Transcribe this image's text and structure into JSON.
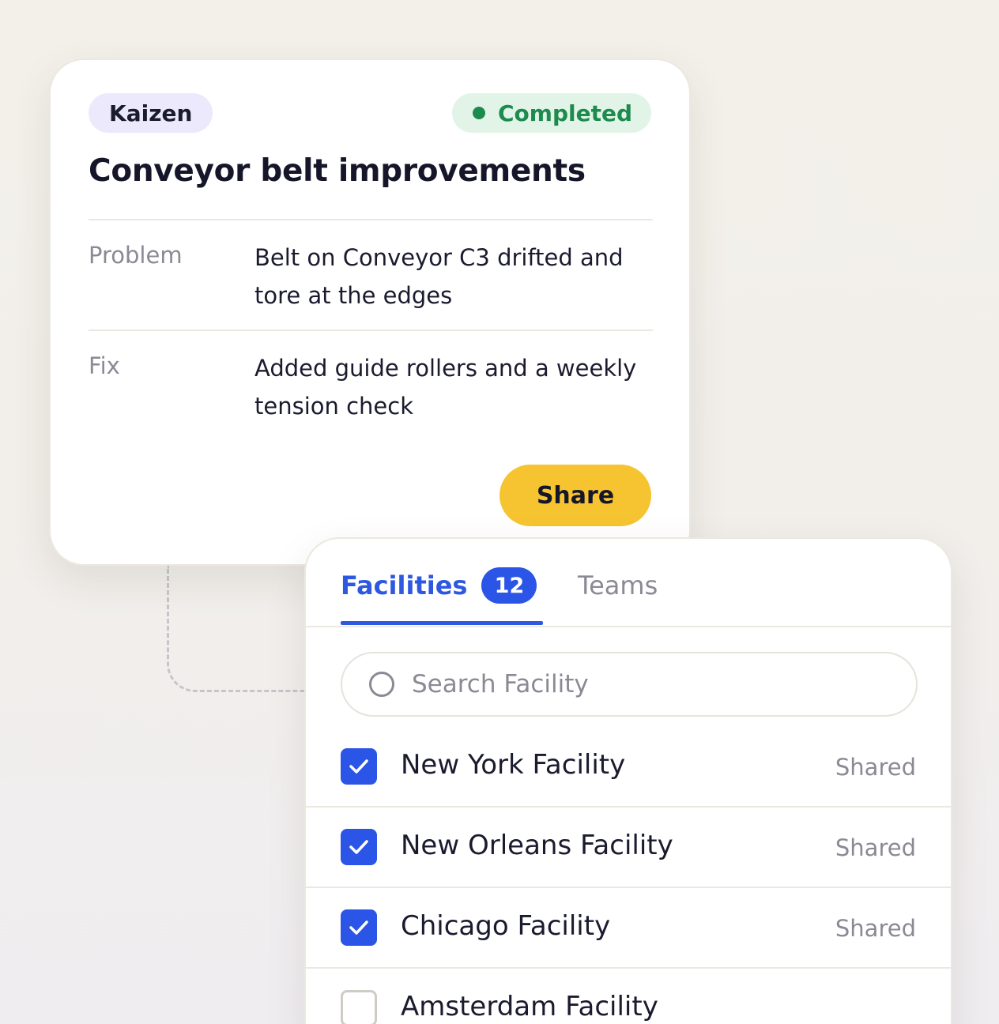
{
  "card": {
    "tag": "Kaizen",
    "status": "Completed",
    "title": "Conveyor belt improvements",
    "rows": [
      {
        "label": "Problem",
        "text": "Belt on Conveyor C3 drifted and tore at the edges"
      },
      {
        "label": "Fix",
        "text": "Added guide rollers and a weekly tension check"
      }
    ],
    "share_label": "Share"
  },
  "panel": {
    "tabs": [
      {
        "label": "Facilities",
        "count": "12",
        "active": true
      },
      {
        "label": "Teams",
        "active": false
      }
    ],
    "search": {
      "placeholder": "Search Facility",
      "value": ""
    },
    "facilities": [
      {
        "name": "New York Facility",
        "status": "Shared",
        "checked": true
      },
      {
        "name": "New Orleans Facility",
        "status": "Shared",
        "checked": true
      },
      {
        "name": "Chicago Facility",
        "status": "Shared",
        "checked": true
      },
      {
        "name": "Amsterdam Facility",
        "status": "",
        "checked": false
      }
    ]
  },
  "colors": {
    "accent": "#2e58e0",
    "share_button": "#f5c430",
    "status_green": "#1d8a4e",
    "tag_bg": "#ebe9fb"
  }
}
